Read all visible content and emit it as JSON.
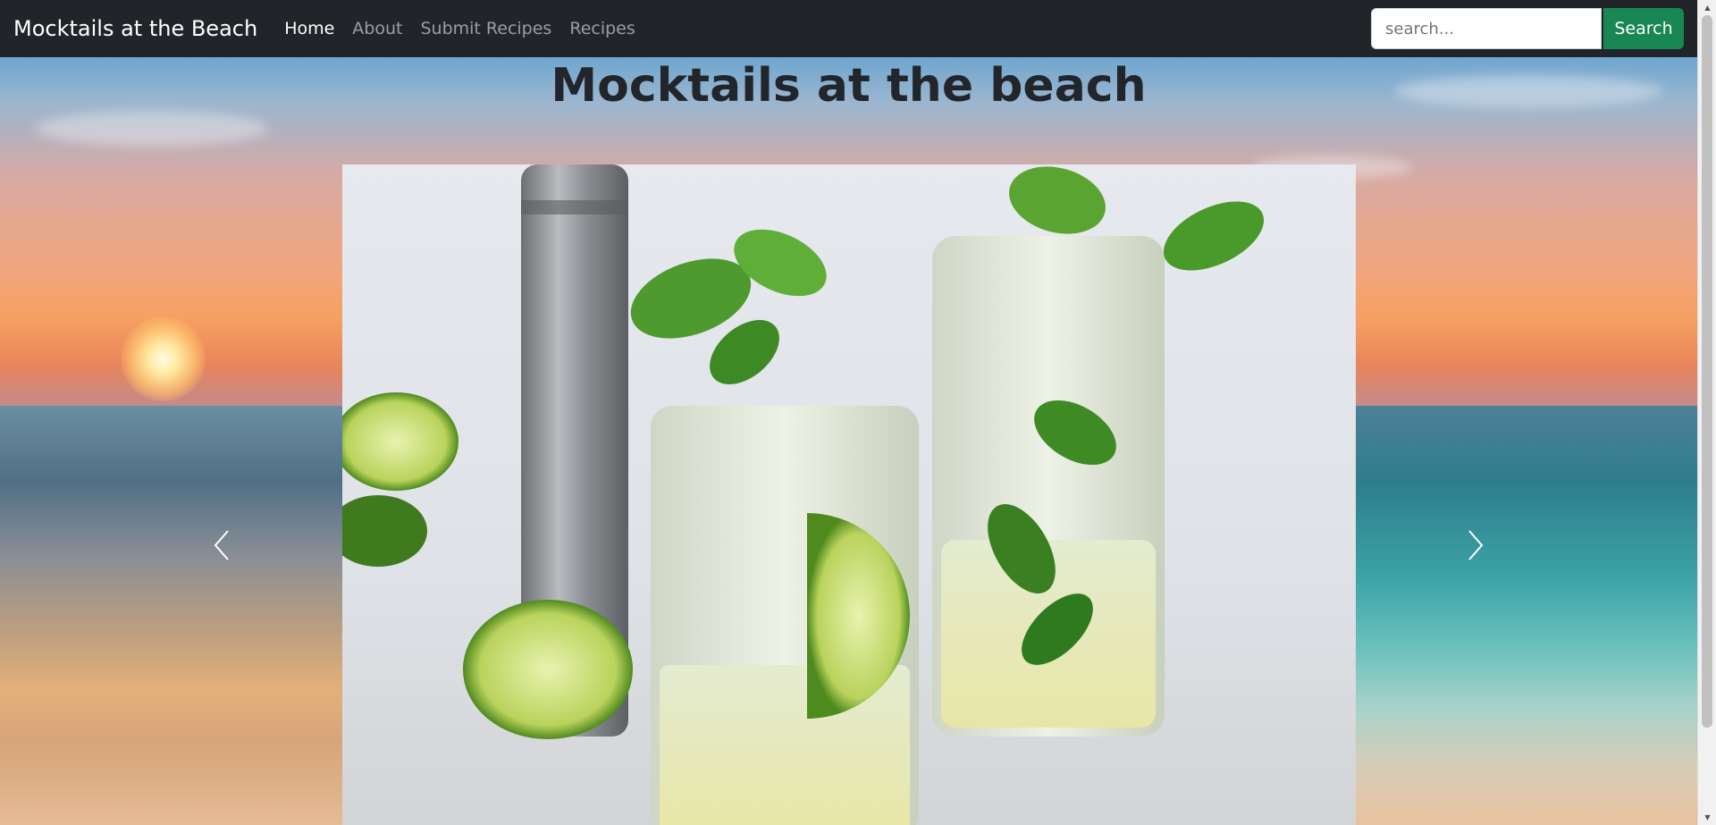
{
  "navbar": {
    "brand": "Mocktails at the Beach",
    "links": [
      {
        "label": "Home",
        "active": true
      },
      {
        "label": "About",
        "active": false
      },
      {
        "label": "Submit Recipes",
        "active": false
      },
      {
        "label": "Recipes",
        "active": false
      }
    ],
    "search": {
      "placeholder": "search...",
      "value": "",
      "button_label": "Search"
    }
  },
  "main": {
    "title": "Mocktails at the beach"
  },
  "carousel": {
    "prev_icon": "chevron-left-icon",
    "next_icon": "chevron-right-icon"
  },
  "colors": {
    "navbar_bg": "#212529",
    "search_button": "#198754",
    "title_text": "#22262b"
  }
}
